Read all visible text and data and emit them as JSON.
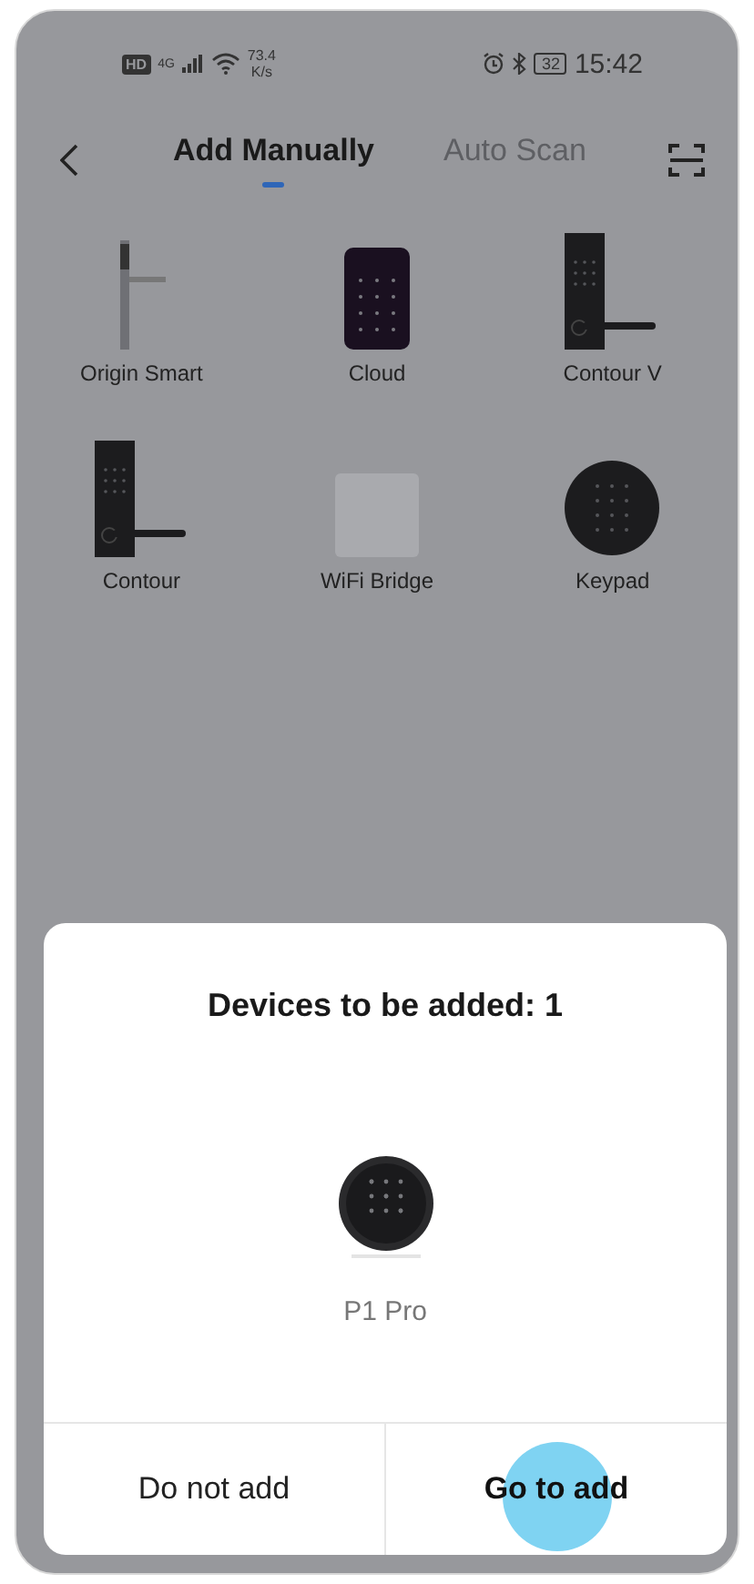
{
  "status_bar": {
    "hd": "HD",
    "network": "4G",
    "speed_value": "73.4",
    "speed_unit": "K/s",
    "battery": "32",
    "time": "15:42"
  },
  "tabs": [
    {
      "label": "Add Manually",
      "selected": true
    },
    {
      "label": "Auto Scan",
      "selected": false
    }
  ],
  "devices": [
    {
      "name": "Origin Smart",
      "kind": "slim-lever"
    },
    {
      "name": "Cloud",
      "kind": "keypad-panel"
    },
    {
      "name": "Contour V",
      "kind": "lever"
    },
    {
      "name": "Contour",
      "kind": "lever"
    },
    {
      "name": "WiFi Bridge",
      "kind": "bridge"
    },
    {
      "name": "Keypad",
      "kind": "round-keypad"
    }
  ],
  "dialog": {
    "title": "Devices to be added: 1",
    "device": {
      "name": "P1 Pro",
      "kind": "round-keypad"
    },
    "buttons": [
      {
        "label": "Do not add",
        "primary": false,
        "touched": false
      },
      {
        "label": "Go to add",
        "primary": true,
        "touched": true
      }
    ]
  }
}
